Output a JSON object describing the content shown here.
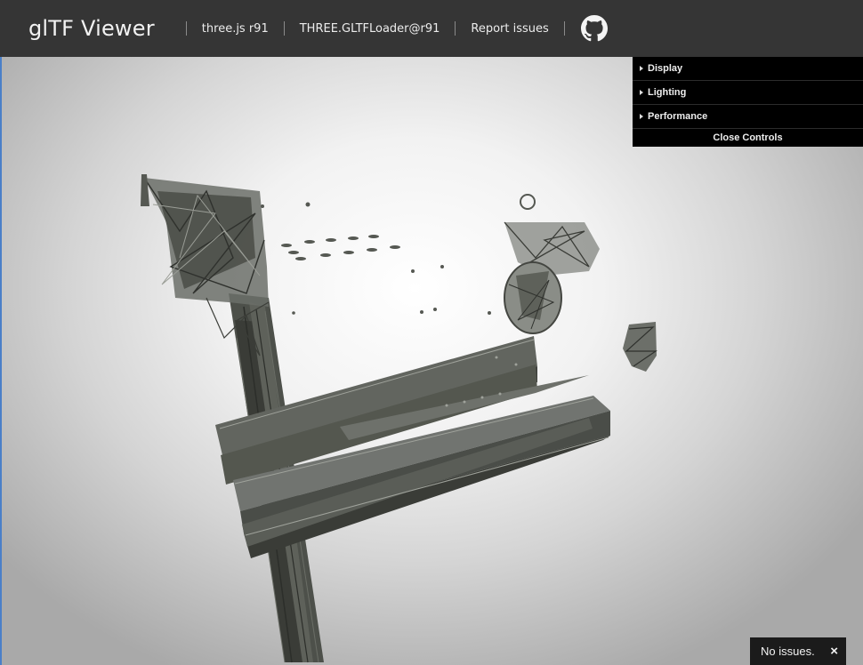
{
  "header": {
    "title": "glTF Viewer",
    "links": [
      "three.js r91",
      "THREE.GLTFLoader@r91",
      "Report issues"
    ],
    "github_icon": "github-icon"
  },
  "controls": {
    "folders": [
      "Display",
      "Lighting",
      "Performance"
    ],
    "close_label": "Close Controls"
  },
  "status": {
    "message": "No issues.",
    "dismiss": "×"
  },
  "colors": {
    "header_bg": "#353535",
    "panel_bg": "#000000",
    "mesh": "#4a4d48"
  }
}
